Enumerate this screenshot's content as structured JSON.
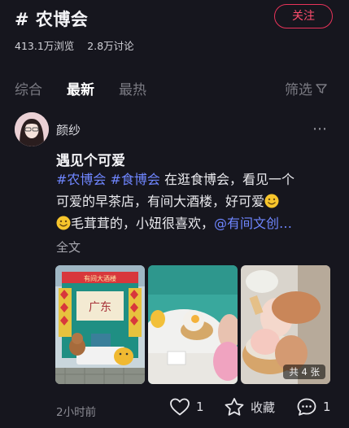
{
  "header": {
    "topic": "# 农博会",
    "follow_label": "关注",
    "views": "413.1万浏览",
    "discussions": "2.8万讨论"
  },
  "tabs": [
    {
      "label": "综合",
      "active": false
    },
    {
      "label": "最新",
      "active": true
    },
    {
      "label": "最热",
      "active": false
    }
  ],
  "filter": {
    "label": "筛选",
    "icon": "filter-icon"
  },
  "post": {
    "author": "颜纱",
    "title": "遇见个可爱",
    "tag1": "#农博会",
    "tag2": "#食博会",
    "line1_text": "在逛食博会，看见一个",
    "line2_text": "可爱的早茶店，有间大酒楼，好可爱",
    "line3_text": "毛茸茸的，小妞很喜欢，",
    "mention": "@有间文创…",
    "fulltext_label": "全文",
    "photo_sign_text": "广东",
    "photo_banner_text": "有间大酒楼",
    "image_count": "共 4 张",
    "time": "2小时前",
    "likes": "1",
    "favorite_label": "收藏",
    "comments": "1"
  },
  "colors": {
    "background": "#16161e",
    "accent": "#e8335a",
    "link": "#6f86ff"
  }
}
